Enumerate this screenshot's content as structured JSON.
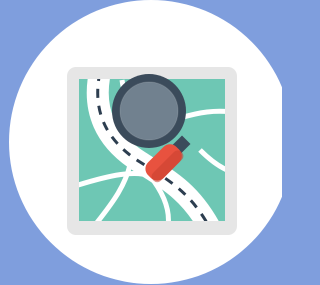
{
  "icon": {
    "name": "map-search-icon",
    "description_tags": [
      "map",
      "magnifying-glass",
      "road"
    ]
  },
  "colors": {
    "background": "#7f9edd",
    "circle": "#ffffff",
    "frame": "#e6e6e6",
    "map_fill": "#6ec7b4",
    "road": "#ffffff",
    "road_dash": "#2d3e50",
    "lens_rim": "#3b4b5b",
    "lens_glass": "#d8e8f0",
    "handle": "#e8523f",
    "handle_dark": "#c7402f"
  }
}
